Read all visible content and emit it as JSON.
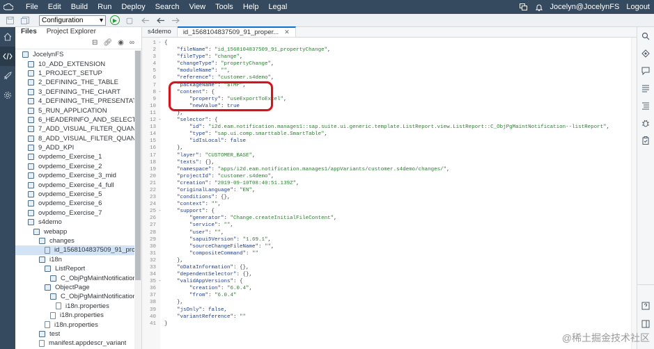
{
  "menubar": {
    "items": [
      "File",
      "Edit",
      "Build",
      "Run",
      "Deploy",
      "Search",
      "View",
      "Tools",
      "Help",
      "Legal"
    ],
    "user": "Jocelyn@JocelynFS",
    "logout": "Logout"
  },
  "toolbar": {
    "configuration": "Configuration"
  },
  "files": {
    "tabs": [
      "Files",
      "Project Explorer"
    ],
    "tree": [
      {
        "label": "JocelynFS",
        "indent": 0,
        "type": "folder"
      },
      {
        "label": "10_ADD_EXTENSION",
        "indent": 1,
        "type": "folder"
      },
      {
        "label": "1_PROJECT_SETUP",
        "indent": 1,
        "type": "folder"
      },
      {
        "label": "2_DEFINING_THE_TABLE",
        "indent": 1,
        "type": "folder"
      },
      {
        "label": "3_DEFINING_THE_CHART",
        "indent": 1,
        "type": "folder"
      },
      {
        "label": "4_DEFINING_THE_PRESENTATION_VA",
        "indent": 1,
        "type": "folder"
      },
      {
        "label": "5_RUN_APPLICATION",
        "indent": 1,
        "type": "folder"
      },
      {
        "label": "6_HEADERINFO_AND_SELECTION_FIE",
        "indent": 1,
        "type": "folder"
      },
      {
        "label": "7_ADD_VISUAL_FILTER_QUANTITY_BY",
        "indent": 1,
        "type": "folder"
      },
      {
        "label": "8_ADD_VISUAL_FILTER_QUANTITY_BY",
        "indent": 1,
        "type": "folder"
      },
      {
        "label": "9_ADD_KPI",
        "indent": 1,
        "type": "folder"
      },
      {
        "label": "ovpdemo_Exercise_1",
        "indent": 1,
        "type": "folder"
      },
      {
        "label": "ovpdemo_Exercise_2",
        "indent": 1,
        "type": "folder"
      },
      {
        "label": "ovpdemo_Exercise_3_mid",
        "indent": 1,
        "type": "folder"
      },
      {
        "label": "ovpdemo_Exercise_4_full",
        "indent": 1,
        "type": "folder"
      },
      {
        "label": "ovpdemo_Exercise_5",
        "indent": 1,
        "type": "folder"
      },
      {
        "label": "ovpdemo_Exercise_6",
        "indent": 1,
        "type": "folder"
      },
      {
        "label": "ovpdemo_Exercise_7",
        "indent": 1,
        "type": "folder"
      },
      {
        "label": "s4demo",
        "indent": 1,
        "type": "folder"
      },
      {
        "label": "webapp",
        "indent": 2,
        "type": "folder"
      },
      {
        "label": "changes",
        "indent": 3,
        "type": "folder"
      },
      {
        "label": "id_1568104837509_91_property",
        "indent": 4,
        "type": "file",
        "selected": true
      },
      {
        "label": "i18n",
        "indent": 3,
        "type": "folder"
      },
      {
        "label": "ListReport",
        "indent": 4,
        "type": "folder"
      },
      {
        "label": "C_ObjPgMaintNotification",
        "indent": 5,
        "type": "folder"
      },
      {
        "label": "ObjectPage",
        "indent": 4,
        "type": "folder"
      },
      {
        "label": "C_ObjPgMaintNotification",
        "indent": 5,
        "type": "folder"
      },
      {
        "label": "i18n.properties",
        "indent": 6,
        "type": "file"
      },
      {
        "label": "i18n.properties",
        "indent": 5,
        "type": "file"
      },
      {
        "label": "i18n.properties",
        "indent": 4,
        "type": "file"
      },
      {
        "label": "test",
        "indent": 3,
        "type": "folder"
      },
      {
        "label": "manifest.appdescr_variant",
        "indent": 3,
        "type": "file"
      }
    ]
  },
  "editor": {
    "tabs": [
      {
        "label": "s4demo",
        "active": false
      },
      {
        "label": "id_1568104837509_91_proper...",
        "active": true
      }
    ],
    "lines": [
      {
        "n": "1",
        "f": "-",
        "t": "{"
      },
      {
        "n": "2",
        "f": "",
        "t": "    \"fileName\": \"id_1568104837509_91_propertyChange\","
      },
      {
        "n": "3",
        "f": "",
        "t": "    \"fileType\": \"change\","
      },
      {
        "n": "4",
        "f": "",
        "t": "    \"changeType\": \"propertyChange\","
      },
      {
        "n": "5",
        "f": "",
        "t": "    \"moduleName\": \"\","
      },
      {
        "n": "6",
        "f": "",
        "t": "    \"reference\": \"customer.s4demo\","
      },
      {
        "n": "7",
        "f": "",
        "t": "    \"packageName\": \"$TMP\","
      },
      {
        "n": "8",
        "f": "-",
        "t": "    \"content\": {"
      },
      {
        "n": "9",
        "f": "",
        "t": "        \"property\": \"useExportToExcel\","
      },
      {
        "n": "10",
        "f": "",
        "t": "        \"newValue\": true"
      },
      {
        "n": "11",
        "f": "",
        "t": "    },"
      },
      {
        "n": "12",
        "f": "-",
        "t": "    \"selector\": {"
      },
      {
        "n": "13",
        "f": "",
        "t": "        \"id\": \"i2d.eam.notification.manages1::sap.suite.ui.generic.template.ListReport.view.ListReport::C_ObjPgMaintNotification--listReport\","
      },
      {
        "n": "14",
        "f": "",
        "t": "        \"type\": \"sap.ui.comp.smarttable.SmartTable\","
      },
      {
        "n": "15",
        "f": "",
        "t": "        \"idIsLocal\": false"
      },
      {
        "n": "16",
        "f": "",
        "t": "    },"
      },
      {
        "n": "17",
        "f": "",
        "t": "    \"layer\": \"CUSTOMER_BASE\","
      },
      {
        "n": "18",
        "f": "",
        "t": "    \"texts\": {},"
      },
      {
        "n": "19",
        "f": "",
        "t": "    \"namespace\": \"apps/i2d.eam.notification.manages1/appVariants/customer.s4demo/changes/\","
      },
      {
        "n": "20",
        "f": "",
        "t": "    \"projectId\": \"customer.s4demo\","
      },
      {
        "n": "21",
        "f": "",
        "t": "    \"creation\": \"2019-09-10T08:40:51.139Z\","
      },
      {
        "n": "22",
        "f": "",
        "t": "    \"originalLanguage\": \"EN\","
      },
      {
        "n": "23",
        "f": "",
        "t": "    \"conditions\": {},"
      },
      {
        "n": "24",
        "f": "",
        "t": "    \"context\": \"\","
      },
      {
        "n": "25",
        "f": "-",
        "t": "    \"support\": {"
      },
      {
        "n": "26",
        "f": "",
        "t": "        \"generator\": \"Change.createInitialFileContent\","
      },
      {
        "n": "27",
        "f": "",
        "t": "        \"service\": \"\","
      },
      {
        "n": "28",
        "f": "",
        "t": "        \"user\": \"\","
      },
      {
        "n": "29",
        "f": "",
        "t": "        \"sapui5Version\": \"1.69.1\","
      },
      {
        "n": "30",
        "f": "",
        "t": "        \"sourceChangeFileName\": \"\","
      },
      {
        "n": "31",
        "f": "",
        "t": "        \"compositeCommand\": \"\""
      },
      {
        "n": "32",
        "f": "",
        "t": "    },"
      },
      {
        "n": "33",
        "f": "",
        "t": "    \"oDataInformation\": {},"
      },
      {
        "n": "34",
        "f": "",
        "t": "    \"dependentSelector\": {},"
      },
      {
        "n": "35",
        "f": "-",
        "t": "    \"validAppVersions\": {"
      },
      {
        "n": "36",
        "f": "",
        "t": "        \"creation\": \"6.0.4\","
      },
      {
        "n": "37",
        "f": "",
        "t": "        \"from\": \"6.0.4\""
      },
      {
        "n": "38",
        "f": "",
        "t": "    },"
      },
      {
        "n": "39",
        "f": "",
        "t": "    \"jsOnly\": false,"
      },
      {
        "n": "40",
        "f": "",
        "t": "    \"variantReference\": \"\""
      },
      {
        "n": "41",
        "f": "",
        "t": "}"
      }
    ]
  },
  "watermark": "@稀土掘金技术社区",
  "colors": {
    "shell": "#354a5f",
    "accent": "#0a6ed1",
    "highlight": "#d0161c"
  },
  "icons": {
    "activity": [
      "home-icon",
      "code-icon",
      "rocket-icon",
      "settings-icon"
    ],
    "rightbar": [
      "search-icon",
      "diamond-icon",
      "chat-icon",
      "list-icon",
      "outline-icon",
      "bug-icon",
      "clipboard-icon"
    ]
  }
}
